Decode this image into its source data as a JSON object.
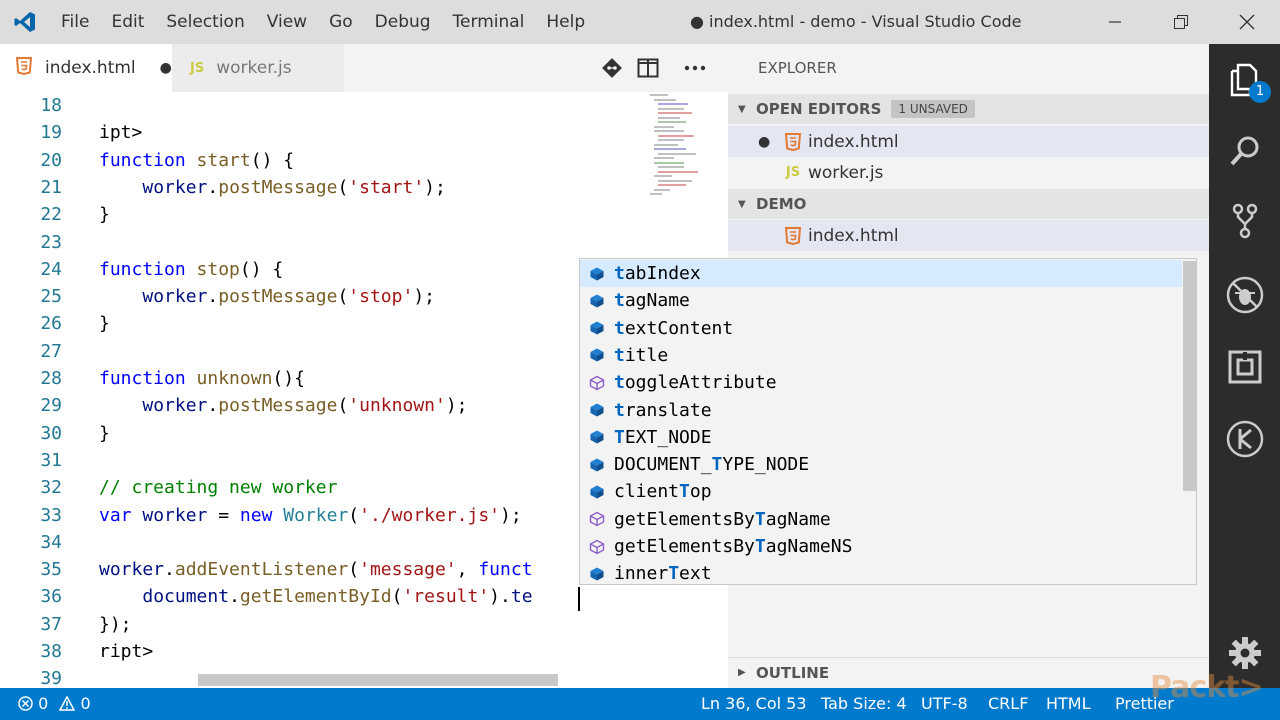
{
  "titlebar": {
    "menu": [
      "File",
      "Edit",
      "Selection",
      "View",
      "Go",
      "Debug",
      "Terminal",
      "Help"
    ],
    "title": "● index.html - demo - Visual Studio Code"
  },
  "tabs": [
    {
      "label": "index.html",
      "icon": "html5-icon",
      "dirty": true
    },
    {
      "label": "worker.js",
      "icon": "js-icon",
      "dirty": false
    }
  ],
  "editor": {
    "lines": [
      {
        "num": "18",
        "html": ""
      },
      {
        "num": "19",
        "html": "ipt>"
      },
      {
        "num": "20",
        "html": "<span class=\"kw\">function</span> <span class=\"fn\">start</span>() {"
      },
      {
        "num": "21",
        "html": "    <span class=\"var\">worker</span>.<span class=\"fn\">postMessage</span>(<span class=\"str\">'start'</span>);"
      },
      {
        "num": "22",
        "html": "}"
      },
      {
        "num": "23",
        "html": ""
      },
      {
        "num": "24",
        "html": "<span class=\"kw\">function</span> <span class=\"fn\">stop</span>() {"
      },
      {
        "num": "25",
        "html": "    <span class=\"var\">worker</span>.<span class=\"fn\">postMessage</span>(<span class=\"str\">'stop'</span>);"
      },
      {
        "num": "26",
        "html": "}"
      },
      {
        "num": "27",
        "html": ""
      },
      {
        "num": "28",
        "html": "<span class=\"kw\">function</span> <span class=\"fn\">unknown</span>(){"
      },
      {
        "num": "29",
        "html": "    <span class=\"var\">worker</span>.<span class=\"fn\">postMessage</span>(<span class=\"str\">'unknown'</span>);"
      },
      {
        "num": "30",
        "html": "}"
      },
      {
        "num": "31",
        "html": ""
      },
      {
        "num": "32",
        "html": "<span class=\"cmt\">// creating new worker</span>"
      },
      {
        "num": "33",
        "html": "<span class=\"kw\">var</span> <span class=\"var\">worker</span> = <span class=\"kw\">new</span> <span class=\"ty\">Worker</span>(<span class=\"str\">'./worker.js'</span>);"
      },
      {
        "num": "34",
        "html": ""
      },
      {
        "num": "35",
        "html": "<span class=\"var\">worker</span>.<span class=\"fn\">addEventListener</span>(<span class=\"str\">'message'</span>, <span class=\"kw\">funct</span>"
      },
      {
        "num": "36",
        "html": "    <span class=\"var\">document</span>.<span class=\"fn\">getElementById</span>(<span class=\"str\">'result'</span>).<span class=\"var\">te</span>"
      },
      {
        "num": "37",
        "html": "});"
      },
      {
        "num": "38",
        "html": "ript>"
      },
      {
        "num": "39",
        "html": ""
      }
    ]
  },
  "sidebar": {
    "header": "EXPLORER",
    "open_editors": {
      "label": "OPEN EDITORS",
      "badge": "1 UNSAVED"
    },
    "open_files": [
      "index.html",
      "worker.js"
    ],
    "demo": {
      "label": "DEMO",
      "files": [
        "index.html"
      ]
    },
    "outline": "OUTLINE"
  },
  "activity": {
    "explorer_badge": "1"
  },
  "suggest": {
    "items": [
      {
        "pre": "",
        "hl": "t",
        "post": "abIndex",
        "kind": "property",
        "selected": true
      },
      {
        "pre": "",
        "hl": "t",
        "post": "agName",
        "kind": "property"
      },
      {
        "pre": "",
        "hl": "t",
        "post": "extContent",
        "kind": "property"
      },
      {
        "pre": "",
        "hl": "t",
        "post": "itle",
        "kind": "property"
      },
      {
        "pre": "",
        "hl": "t",
        "post": "oggleAttribute",
        "kind": "method"
      },
      {
        "pre": "",
        "hl": "t",
        "post": "ranslate",
        "kind": "property"
      },
      {
        "pre": "",
        "hl": "T",
        "post": "EXT_NODE",
        "kind": "property"
      },
      {
        "pre": "DOCUMENT_",
        "hl": "T",
        "post": "YPE_NODE",
        "kind": "property"
      },
      {
        "pre": "client",
        "hl": "T",
        "post": "op",
        "kind": "property"
      },
      {
        "pre": "getElementsBy",
        "hl": "T",
        "post": "agName",
        "kind": "method"
      },
      {
        "pre": "getElementsBy",
        "hl": "T",
        "post": "agNameNS",
        "kind": "method"
      },
      {
        "pre": "inner",
        "hl": "T",
        "post": "ext",
        "kind": "property"
      }
    ]
  },
  "status": {
    "errors": "0",
    "warnings": "0",
    "position": "Ln 36, Col 53",
    "tabsize": "Tab Size: 4",
    "encoding": "UTF-8",
    "eol": "CRLF",
    "language": "HTML",
    "formatter": "Prettier"
  },
  "watermark": "Packt>"
}
